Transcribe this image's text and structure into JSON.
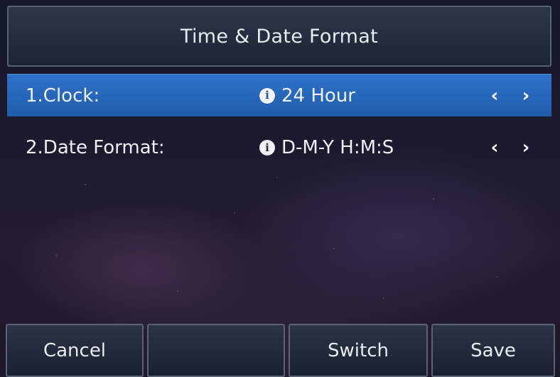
{
  "header": {
    "title": "Time & Date Format"
  },
  "settings": {
    "items": [
      {
        "label": "1.Clock:",
        "value": "24 Hour",
        "selected": true,
        "info_icon": "info-icon",
        "prev_icon": "chevron-left-icon",
        "next_icon": "chevron-right-icon"
      },
      {
        "label": "2.Date Format:",
        "value": "D-M-Y H:M:S",
        "selected": false,
        "info_icon": "info-icon",
        "prev_icon": "chevron-left-icon",
        "next_icon": "chevron-right-icon"
      }
    ]
  },
  "softkeys": [
    {
      "label": "Cancel"
    },
    {
      "label": ""
    },
    {
      "label": "Switch"
    },
    {
      "label": "Save"
    }
  ],
  "colors": {
    "selection": "#2a6cc2",
    "text": "#eef0f4",
    "border": "#5a6275"
  }
}
